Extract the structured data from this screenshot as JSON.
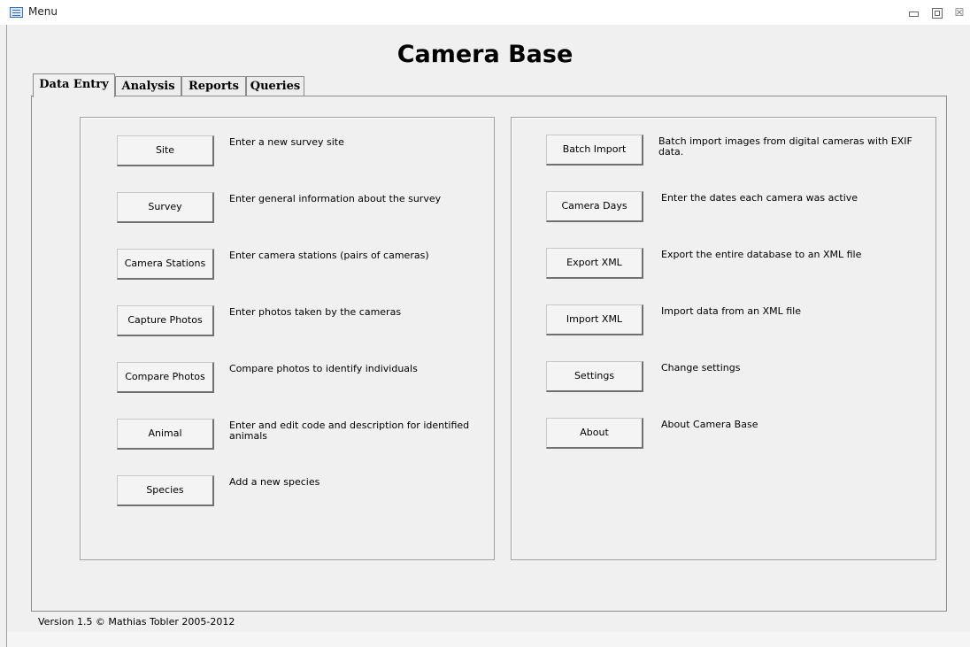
{
  "window": {
    "title": "Menu",
    "minimize_icon": "minimize-icon",
    "maximize_icon": "restore-icon",
    "close_icon": "close-icon",
    "close_glyph": "☒"
  },
  "heading": "Camera Base",
  "tabs": [
    {
      "label": "Data Entry",
      "active": true
    },
    {
      "label": "Analysis",
      "active": false
    },
    {
      "label": "Reports",
      "active": false
    },
    {
      "label": "Queries",
      "active": false
    }
  ],
  "left_panel": [
    {
      "label": "Site",
      "description": "Enter a new survey site"
    },
    {
      "label": "Survey",
      "description": "Enter general information about the survey"
    },
    {
      "label": "Camera Stations",
      "description": "Enter camera stations (pairs of cameras)"
    },
    {
      "label": "Capture Photos",
      "description": "Enter photos taken by the cameras"
    },
    {
      "label": "Compare  Photos",
      "description": "Compare photos to identify individuals"
    },
    {
      "label": "Animal",
      "description": "Enter and edit code and description for identified animals"
    },
    {
      "label": "Species",
      "description": "Add a new species"
    }
  ],
  "right_panel": [
    {
      "label": "Batch Import",
      "description": "Batch import images from digital cameras with EXIF data."
    },
    {
      "label": "Camera Days",
      "description": "Enter the dates each camera was active"
    },
    {
      "label": "Export XML",
      "description": "Export the entire database to an XML file"
    },
    {
      "label": "Import XML",
      "description": "Import data from an XML file"
    },
    {
      "label": "Settings",
      "description": "Change settings"
    },
    {
      "label": "About",
      "description": "About Camera Base"
    }
  ],
  "footer": {
    "version": "Version 1.5  © Mathias Tobler 2005-2012"
  }
}
